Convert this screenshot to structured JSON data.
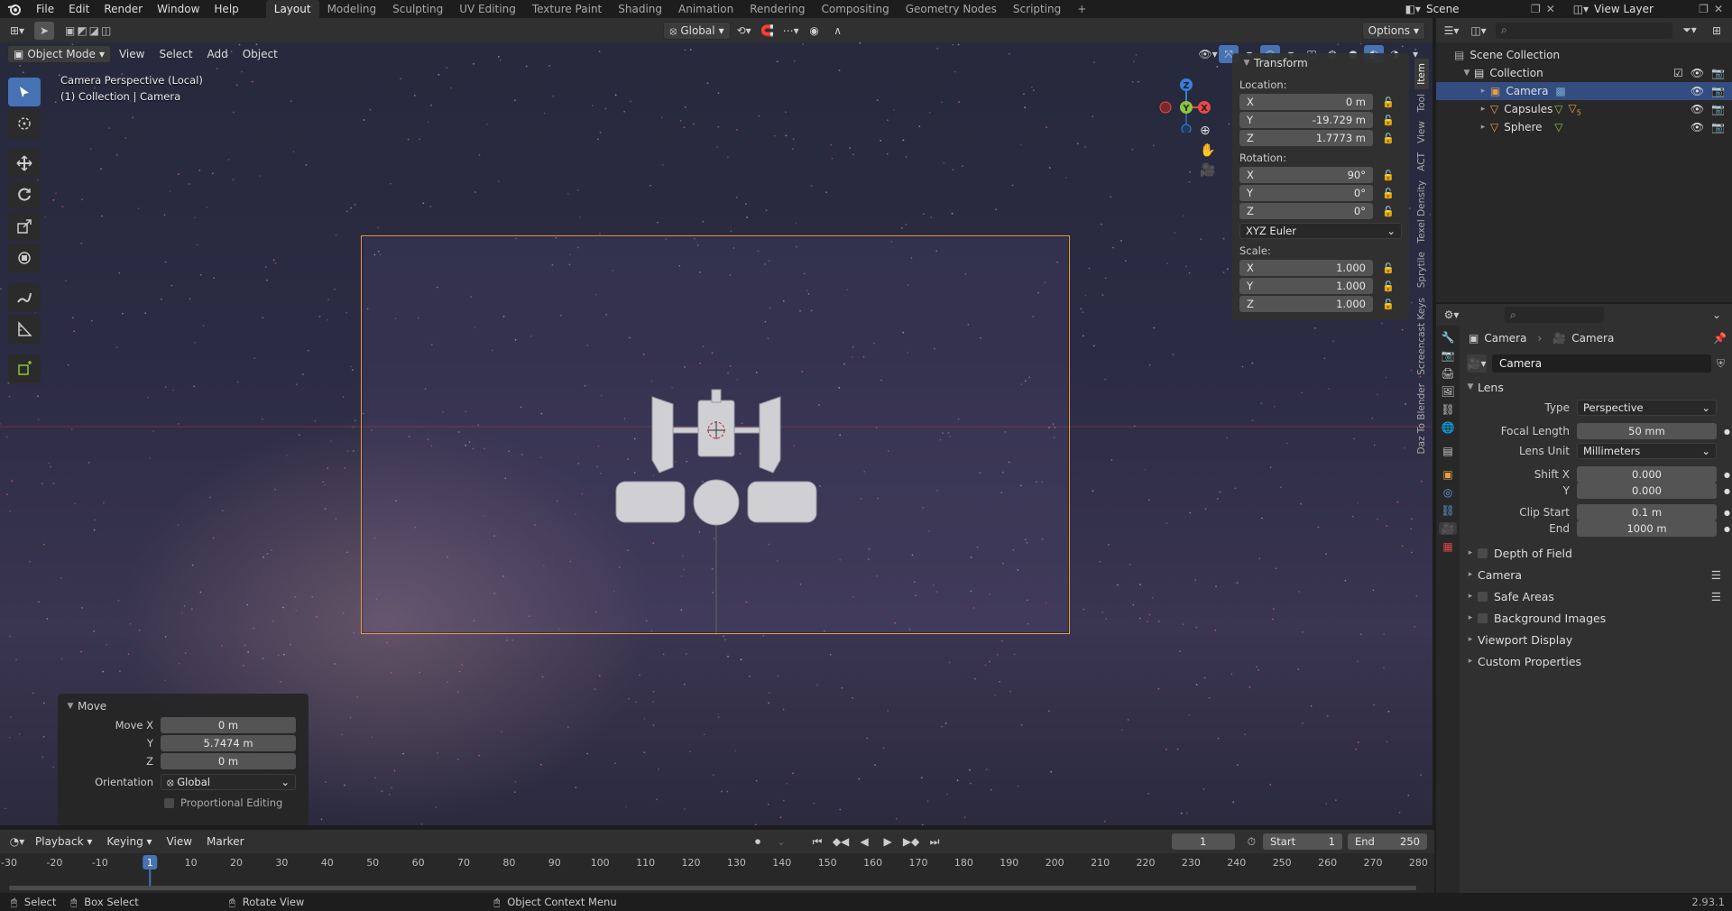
{
  "topbar": {
    "menus": [
      "File",
      "Edit",
      "Render",
      "Window",
      "Help"
    ],
    "workspaces": [
      "Layout",
      "Modeling",
      "Sculpting",
      "UV Editing",
      "Texture Paint",
      "Shading",
      "Animation",
      "Rendering",
      "Compositing",
      "Geometry Nodes",
      "Scripting"
    ],
    "active_workspace": "Layout",
    "scene": "Scene",
    "view_layer": "View Layer"
  },
  "viewport_header": {
    "mode": "Object Mode",
    "menus": [
      "View",
      "Select",
      "Add",
      "Object"
    ],
    "transform_orientation": "Global",
    "options": "Options"
  },
  "viewport": {
    "overlay_line1": "Camera Perspective (Local)",
    "overlay_line2": "(1) Collection | Camera",
    "gizmo": {
      "x": "X",
      "y": "Y",
      "z": "Z"
    }
  },
  "npanel": {
    "title": "Transform",
    "location_label": "Location:",
    "location": [
      {
        "axis": "X",
        "value": "0 m"
      },
      {
        "axis": "Y",
        "value": "-19.729 m"
      },
      {
        "axis": "Z",
        "value": "1.7773 m"
      }
    ],
    "rotation_label": "Rotation:",
    "rotation": [
      {
        "axis": "X",
        "value": "90°"
      },
      {
        "axis": "Y",
        "value": "0°"
      },
      {
        "axis": "Z",
        "value": "0°"
      }
    ],
    "rotation_mode": "XYZ Euler",
    "scale_label": "Scale:",
    "scale": [
      {
        "axis": "X",
        "value": "1.000"
      },
      {
        "axis": "Y",
        "value": "1.000"
      },
      {
        "axis": "Z",
        "value": "1.000"
      }
    ],
    "tabs": [
      "Item",
      "Tool",
      "View",
      "ACT",
      "Texel Density",
      "Sprytile",
      "Screencast Keys",
      "Daz To Blender"
    ]
  },
  "operator_panel": {
    "title": "Move",
    "move_x_label": "Move X",
    "move_x": "0 m",
    "y_label": "Y",
    "y": "5.7474 m",
    "z_label": "Z",
    "z": "0 m",
    "orientation_label": "Orientation",
    "orientation": "Global",
    "proportional": "Proportional Editing"
  },
  "outliner": {
    "scene_collection": "Scene Collection",
    "collection": "Collection",
    "items": [
      {
        "name": "Camera",
        "selected": true
      },
      {
        "name": "Capsules",
        "selected": false,
        "badge": "5"
      },
      {
        "name": "Sphere",
        "selected": false
      }
    ]
  },
  "properties": {
    "breadcrumb_object": "Camera",
    "breadcrumb_data": "Camera",
    "datablock": "Camera",
    "lens_section": "Lens",
    "type_label": "Type",
    "type": "Perspective",
    "focal_label": "Focal Length",
    "focal": "50 mm",
    "lens_unit_label": "Lens Unit",
    "lens_unit": "Millimeters",
    "shift_x_label": "Shift X",
    "shift_x": "0.000",
    "shift_y_label": "Y",
    "shift_y": "0.000",
    "clip_start_label": "Clip Start",
    "clip_start": "0.1 m",
    "clip_end_label": "End",
    "clip_end": "1000 m",
    "sections": [
      "Depth of Field",
      "Camera",
      "Safe Areas",
      "Background Images",
      "Viewport Display",
      "Custom Properties"
    ]
  },
  "timeline": {
    "menus": [
      "Playback",
      "Keying",
      "View",
      "Marker"
    ],
    "current_frame": "1",
    "start_label": "Start",
    "start": "1",
    "end_label": "End",
    "end": "250",
    "ruler": [
      "-30",
      "-20",
      "-10",
      "1",
      "10",
      "20",
      "30",
      "40",
      "50",
      "60",
      "70",
      "80",
      "90",
      "100",
      "110",
      "120",
      "130",
      "140",
      "150",
      "160",
      "170",
      "180",
      "190",
      "200",
      "210",
      "220",
      "230",
      "240",
      "250",
      "260",
      "270",
      "280"
    ]
  },
  "statusbar": {
    "select": "Select",
    "box_select": "Box Select",
    "rotate_view": "Rotate View",
    "context_menu": "Object Context Menu",
    "version": "2.93.1"
  },
  "colors": {
    "accent": "#4772b3",
    "camera_frame": "#e8a040",
    "axis_x": "#e54a4a",
    "axis_y": "#8cc53f",
    "axis_z": "#3a7fd5"
  }
}
